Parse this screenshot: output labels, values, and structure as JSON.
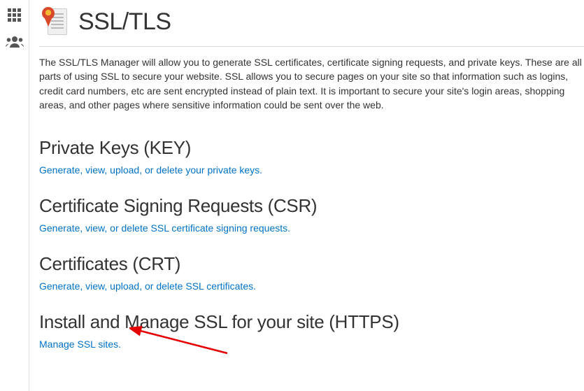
{
  "page": {
    "title": "SSL/TLS",
    "intro": "The SSL/TLS Manager will allow you to generate SSL certificates, certificate signing requests, and private keys. These are all parts of using SSL to secure your website. SSL allows you to secure pages on your site so that information such as logins, credit card numbers, etc are sent encrypted instead of plain text. It is important to secure your site's login areas, shopping areas, and other pages where sensitive information could be sent over the web."
  },
  "sections": [
    {
      "heading": "Private Keys (KEY)",
      "link": "Generate, view, upload, or delete your private keys."
    },
    {
      "heading": "Certificate Signing Requests (CSR)",
      "link": "Generate, view, or delete SSL certificate signing requests."
    },
    {
      "heading": "Certificates (CRT)",
      "link": "Generate, view, upload, or delete SSL certificates."
    },
    {
      "heading": "Install and Manage SSL for your site (HTTPS)",
      "link": "Manage SSL sites."
    }
  ]
}
